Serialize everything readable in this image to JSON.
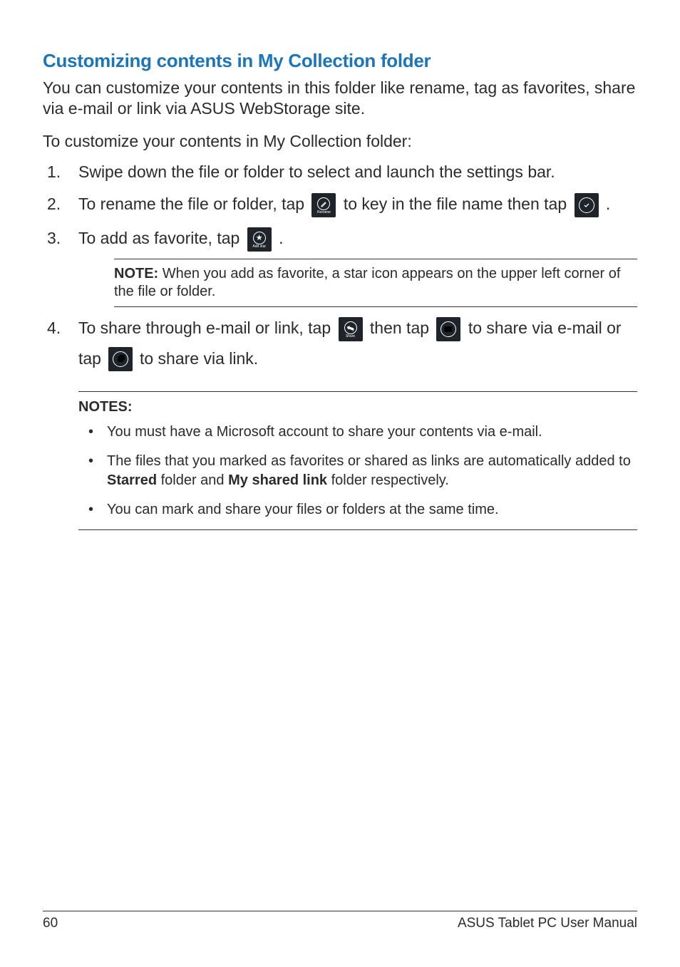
{
  "heading": "Customizing contents in My Collection folder",
  "intro": "You can customize your contents in this folder like rename, tag as favorites, share via e-mail or link via ASUS WebStorage site.",
  "lead": "To customize your contents in My Collection folder:",
  "steps": {
    "s1": "Swipe down the file or folder to select and launch the settings bar.",
    "s2a": "To rename the file or folder, tap ",
    "s2b": " to key in the file name then tap ",
    "s2c": " .",
    "s3a": "To add as favorite, tap ",
    "s3b": " .",
    "s4a": "To share through e-mail or link, tap ",
    "s4b": " then tap ",
    "s4c": " to share via e-mail or",
    "s4d": "tap ",
    "s4e": " to share via link."
  },
  "icons": {
    "rename_label": "Rename",
    "addstar_label": "Add star",
    "share_label": "Share"
  },
  "note_block": {
    "label": "NOTE:",
    "text": "  When you add as favorite, a star icon appears on the upper left corner of the file or folder."
  },
  "notes": {
    "heading": "NOTES:",
    "n1": "You must have a Microsoft account to share your contents via e-mail.",
    "n2a": "The files that you marked as favorites or shared as links are automatically added to ",
    "n2b_bold": "Starred",
    "n2c": " folder and ",
    "n2d_bold": "My shared link",
    "n2e": " folder respectively.",
    "n3": "You can mark and share your files or folders at the same time."
  },
  "footer": {
    "page": "60",
    "manual": "ASUS Tablet PC User Manual"
  }
}
